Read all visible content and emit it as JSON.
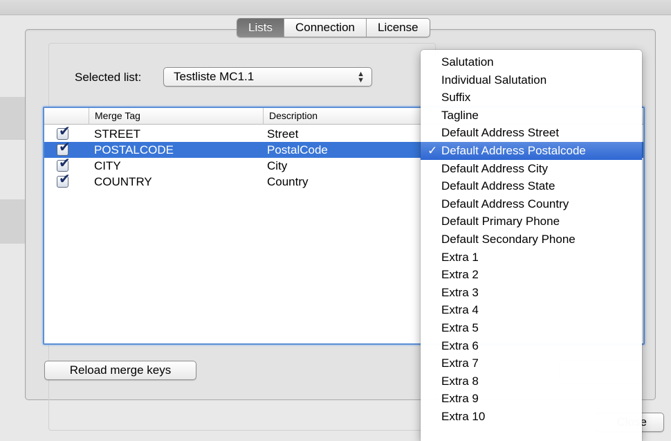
{
  "tabs": [
    {
      "label": "Lists",
      "selected": true
    },
    {
      "label": "Connection",
      "selected": false
    },
    {
      "label": "License",
      "selected": false
    }
  ],
  "selected_list": {
    "label": "Selected list:",
    "value": "Testliste MC1.1"
  },
  "table": {
    "columns": [
      "Merge Tag",
      "Description"
    ],
    "rows": [
      {
        "tag": "STREET",
        "description": "Street",
        "checked": true,
        "selected": false
      },
      {
        "tag": "POSTALCODE",
        "description": "PostalCode",
        "checked": true,
        "selected": true
      },
      {
        "tag": "CITY",
        "description": "City",
        "checked": true,
        "selected": false
      },
      {
        "tag": "COUNTRY",
        "description": "Country",
        "checked": true,
        "selected": false
      }
    ]
  },
  "reload_button": "Reload merge keys",
  "close_button": "Close",
  "menu": {
    "items": [
      "Salutation",
      "Individual Salutation",
      "Suffix",
      "Tagline",
      "Default Address Street",
      "Default Address Postalcode",
      "Default Address City",
      "Default Address State",
      "Default Address Country",
      "Default Primary Phone",
      "Default Secondary Phone",
      "Extra 1",
      "Extra 2",
      "Extra 3",
      "Extra 4",
      "Extra 5",
      "Extra 6",
      "Extra 7",
      "Extra 8",
      "Extra 9",
      "Extra 10"
    ],
    "selected": "Default Address Postalcode",
    "check_glyph": "✓"
  },
  "icons": {
    "checkbox_mark": "✔",
    "popup_up": "▲",
    "popup_down": "▼"
  },
  "colors": {
    "selection": "#3875d7",
    "focus_ring": "#5b8fd6"
  }
}
